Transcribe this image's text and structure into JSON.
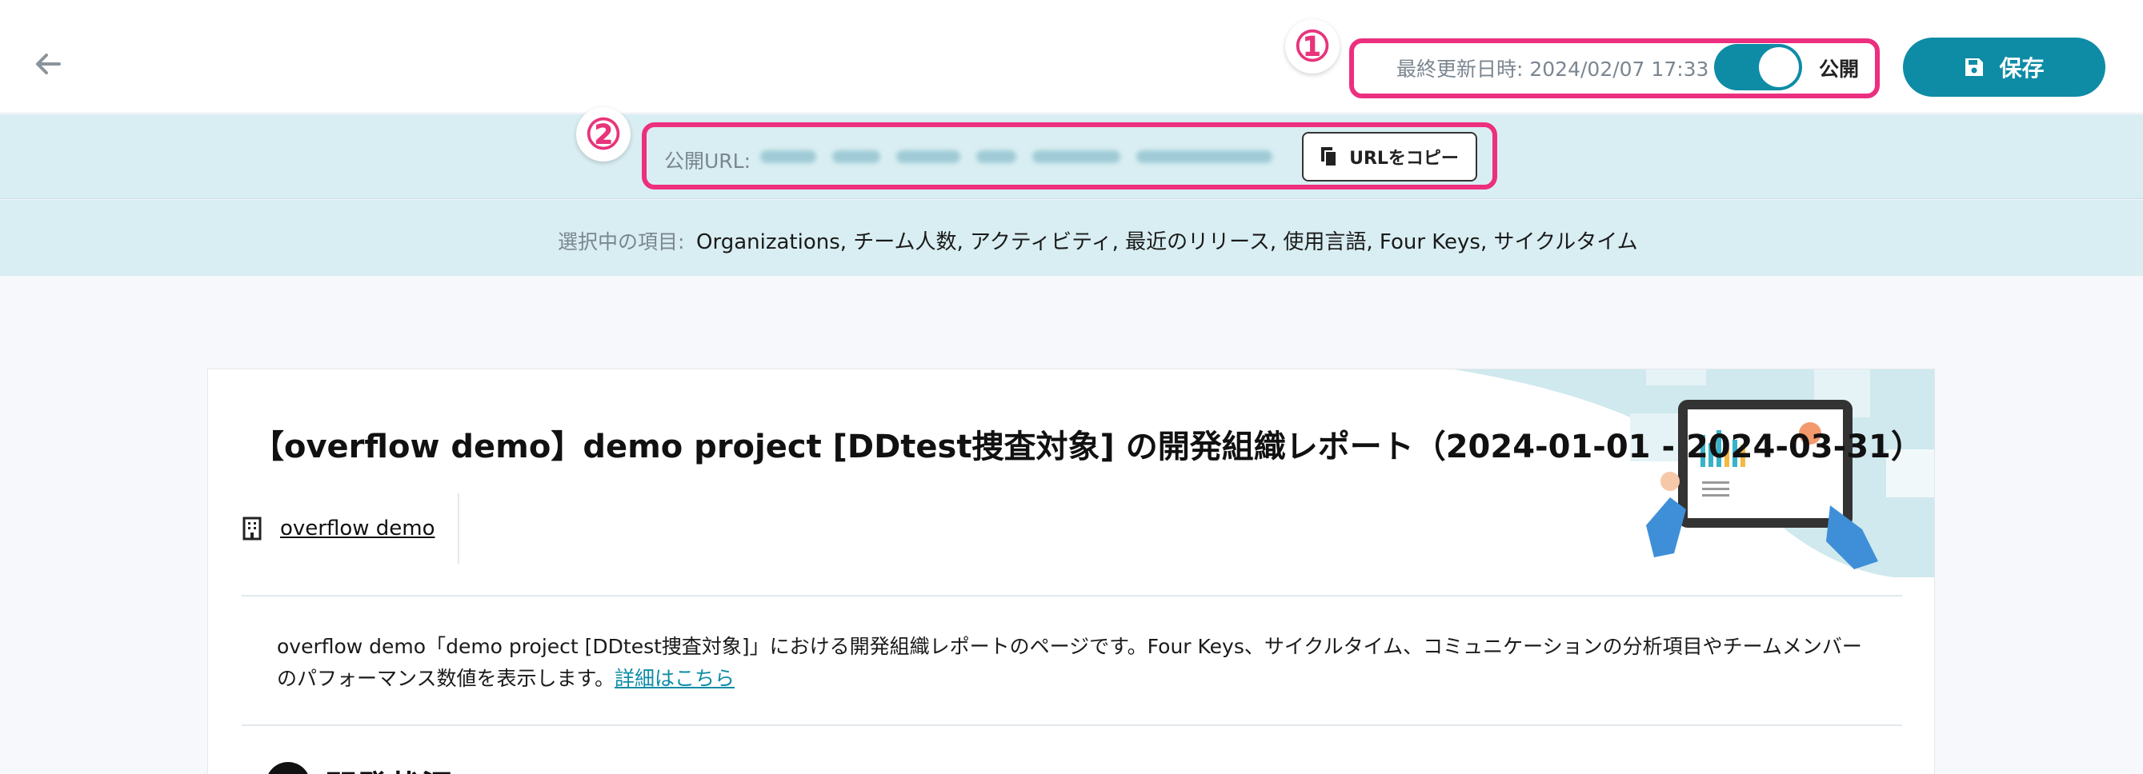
{
  "header": {
    "last_updated": "最終更新日時: 2024/02/07 17:33",
    "publish_label": "公開",
    "publish_on": true,
    "save_label": "保存"
  },
  "annotations": {
    "marker_1": "①",
    "marker_2": "②",
    "highlight_color": "#ec2f7f"
  },
  "url_bar": {
    "label": "公開URL:",
    "copy_label": "URLをコピー"
  },
  "selection": {
    "label": "選択中の項目:",
    "items": "Organizations, チーム人数, アクティビティ, 最近のリリース, 使用言語, Four Keys, サイクルタイム"
  },
  "report": {
    "title": "【overflow demo】demo project [DDtest捜査対象] の開発組織レポート（2024-01-01 - 2024-03-31）",
    "org_link": "overflow demo",
    "description": "overflow demo「demo project [DDtest捜査対象]」における開発組織レポートのページです。Four Keys、サイクルタイム、コミュニケーションの分析項目やチームメンバーのパフォーマンス数値を表示します。",
    "details_link": "詳細はこちら",
    "section_title": "開発状況"
  },
  "colors": {
    "accent": "#0e8ca6",
    "band": "#d9eef2"
  },
  "icons": {
    "back": "arrow-left-icon",
    "save": "floppy-disk-icon",
    "copy": "copy-icon",
    "org": "building-icon"
  }
}
